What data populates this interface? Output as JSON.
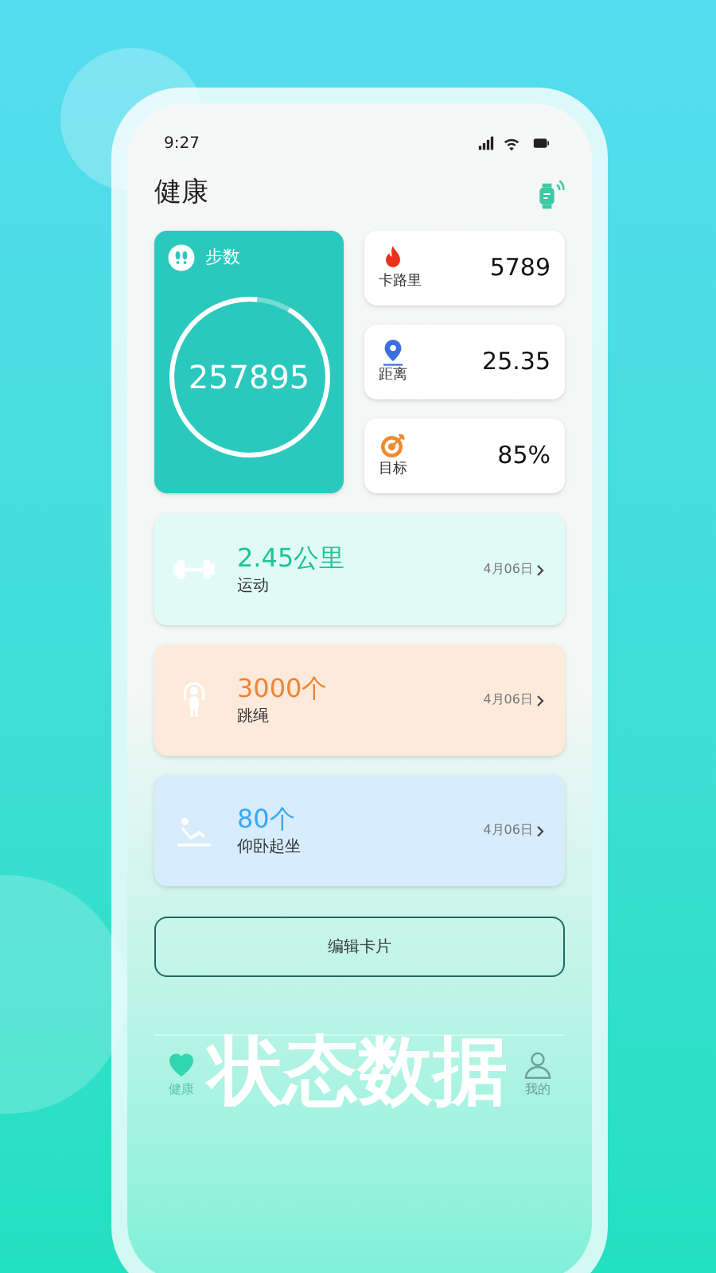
{
  "status_bar": {
    "time": "9:27"
  },
  "header": {
    "title": "健康"
  },
  "steps": {
    "label": "步数",
    "value": "257895",
    "level": 0.93
  },
  "stats": [
    {
      "kind": "calories",
      "label": "卡路里",
      "value": "5789"
    },
    {
      "kind": "distance",
      "label": "距离",
      "value": "25.35"
    },
    {
      "kind": "goal",
      "label": "目标",
      "value": "85%"
    }
  ],
  "activities": [
    {
      "kind": "workout",
      "value": "2.45公里",
      "label": "运动",
      "date": "4月06日"
    },
    {
      "kind": "rope",
      "value": "3000个",
      "label": "跳绳",
      "date": "4月06日"
    },
    {
      "kind": "situp",
      "value": "80个",
      "label": "仰卧起坐",
      "date": "4月06日"
    }
  ],
  "edit_button": "编辑卡片",
  "tab_bar": [
    {
      "kind": "health",
      "label": "健康",
      "selected": true
    },
    {
      "kind": "me",
      "label": "我的",
      "selected": false
    }
  ],
  "caption": "状态数据"
}
